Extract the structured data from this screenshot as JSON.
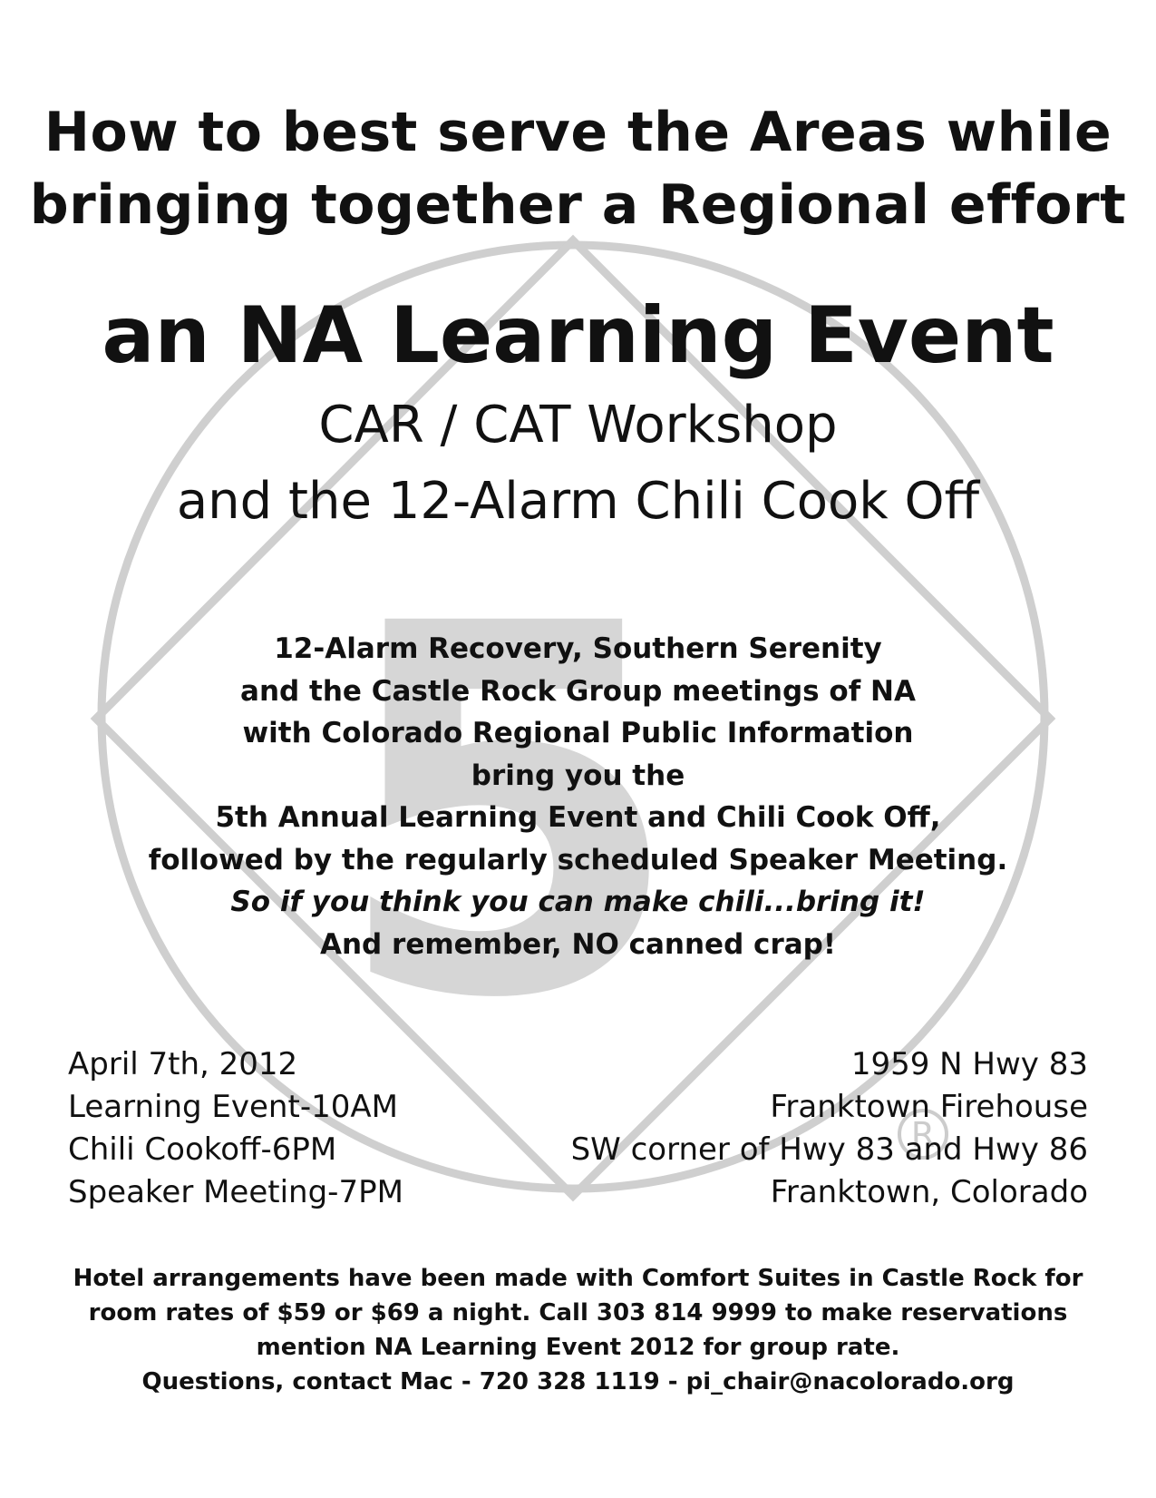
{
  "heading": {
    "line1": "How to best serve the Areas while",
    "line2": "bringing together a Regional effort"
  },
  "event_title": "an NA Learning Event",
  "subtitle": {
    "line1": "CAR / CAT Workshop",
    "line2": "and the 12-Alarm Chili Cook Off"
  },
  "body": {
    "line1": "12-Alarm Recovery, Southern Serenity",
    "line2": "and the Castle Rock Group meetings of NA",
    "line3": "with Colorado Regional Public Information",
    "line4": "bring you the",
    "line5": "5th Annual Learning Event and Chili Cook Off,",
    "line6": "followed by the regularly scheduled Speaker Meeting.",
    "line7": "So if you think you can make chili...bring it!",
    "line8_prefix": "And remember, ",
    "line8_emphasis": "NO",
    "line8_suffix": " canned crap!"
  },
  "schedule": {
    "date": "April 7th, 2012",
    "learning_event": "Learning Event-10AM",
    "chili_cookoff": "Chili Cookoff-6PM",
    "speaker_meeting": "Speaker Meeting-7PM"
  },
  "location": {
    "address": "1959 N Hwy 83",
    "venue": "Franktown Firehouse",
    "corner": "SW corner of Hwy 83 and Hwy 86",
    "city": "Franktown, Colorado"
  },
  "footer": {
    "line1": "Hotel arrangements have been made with Comfort Suites in Castle Rock for",
    "line2": "room rates of $59 or $69 a night. Call 303 814 9999 to make reservations",
    "line3": "mention NA Learning Event 2012 for group rate.",
    "line4": "Questions, contact Mac - 720 328 1119  -  pi_chair@nacolorado.org"
  },
  "watermark": {
    "numeral": "5",
    "mark": "R",
    "color": "#d0d0d0"
  }
}
